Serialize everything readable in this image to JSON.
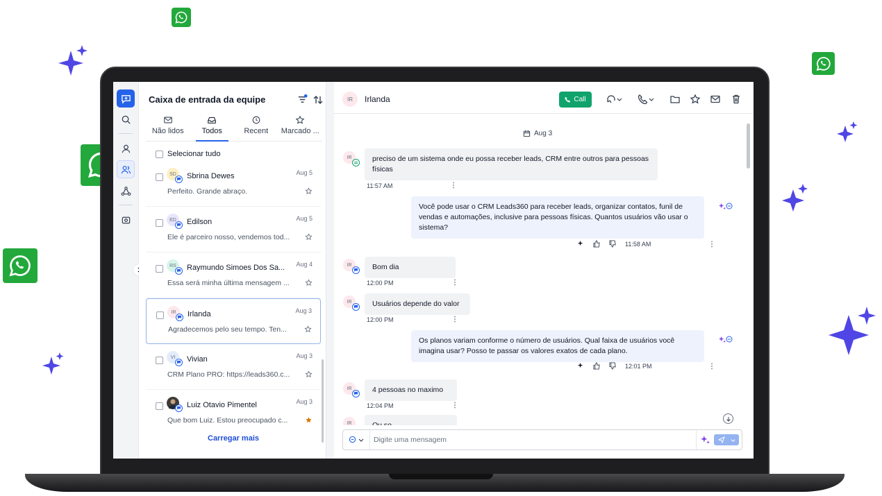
{
  "colors": {
    "accent": "#2563eb",
    "call_green": "#10a36b",
    "whatsapp": "#23a83b",
    "sparkle": "#4f46e5",
    "favorite_star": "#d97706"
  },
  "list": {
    "title": "Caixa de entrada da equipe",
    "tabs": [
      {
        "label": "Não lidos",
        "icon": "mail-icon"
      },
      {
        "label": "Todos",
        "icon": "inbox-icon"
      },
      {
        "label": "Recent",
        "icon": "clock-icon"
      },
      {
        "label": "Marcado ...",
        "icon": "star-icon"
      }
    ],
    "select_all": "Selecionar tudo",
    "conversations": [
      {
        "initials": "SD",
        "name": "Sbrina Dewes",
        "date": "Aug 5",
        "preview": "Perfeito. Grande abraço.",
        "avatar_color": "#fdf0c4",
        "starred": false
      },
      {
        "initials": "ED",
        "name": "Edilson",
        "date": "Aug 5",
        "preview": "Ele é parceiro nosso, vendemos tod...",
        "avatar_color": "#e7e4fb",
        "starred": false
      },
      {
        "initials": "RS",
        "name": "Raymundo Simoes Dos Sa...",
        "date": "Aug 4",
        "preview": "Essa será minha última mensagem ...",
        "avatar_color": "#d6f5ea",
        "starred": false
      },
      {
        "initials": "IR",
        "name": "Irlanda",
        "date": "Aug 3",
        "preview": "Agradecemos pelo seu tempo. Ten...",
        "avatar_color": "#fde8ec",
        "starred": false
      },
      {
        "initials": "VI",
        "name": "Vivian",
        "date": "Aug 3",
        "preview": "CRM Plano PRO: https://leads360.c...",
        "avatar_color": "#e4ecfb",
        "starred": false
      },
      {
        "initials": "",
        "name": "Luiz Otavio Pimentel",
        "date": "Aug 3",
        "preview": "Que bom Luiz. Estou preocupado c...",
        "avatar_color": "#3b3b3b",
        "starred": true
      }
    ],
    "load_more": "Carregar mais"
  },
  "chat": {
    "contact_initials": "IR",
    "contact_name": "Irlanda",
    "call_label": "Call",
    "date_chip": "Aug 3",
    "messages": [
      {
        "dir": "in",
        "text": "preciso de um sistema onde eu possa receber leads, CRM entre outros para pessoas físicas",
        "time": "11:57 AM"
      },
      {
        "dir": "out",
        "text": "Você pode usar o CRM Leads360 para receber leads, organizar contatos, funil de vendas e automações, inclusive para pessoas físicas. Quantos usuários vão usar o sistema?",
        "time": "11:58 AM"
      },
      {
        "dir": "in",
        "text": "Bom dia",
        "time": "12:00 PM"
      },
      {
        "dir": "in",
        "text": "Usuários depende do valor",
        "time": "12:00 PM"
      },
      {
        "dir": "out",
        "text": "Os planos variam conforme o número de usuários. Qual faixa de usuários você imagina usar? Posso te passar os valores exatos de cada plano.",
        "time": "12:01 PM"
      },
      {
        "dir": "in",
        "text": "4 pessoas no maximo",
        "time": "12:04 PM"
      },
      {
        "dir": "in",
        "text": "Ou so",
        "time": ""
      }
    ],
    "composer_placeholder": "Digite uma mensagem"
  }
}
